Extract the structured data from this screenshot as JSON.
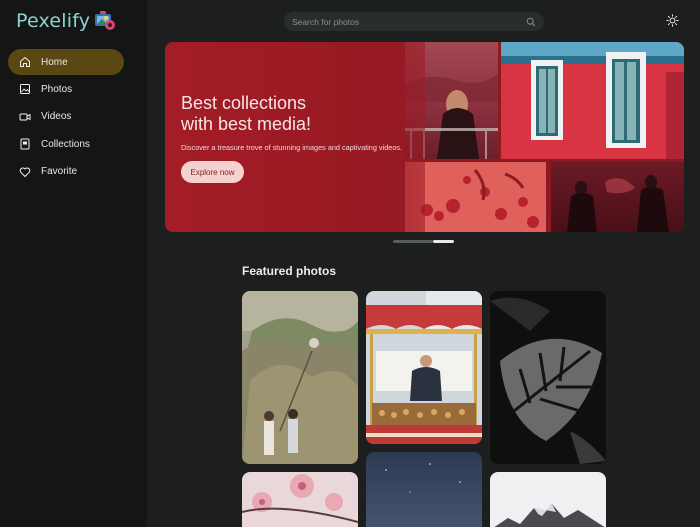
{
  "app": {
    "name": "Pexelify"
  },
  "sidebar": {
    "items": [
      {
        "label": "Home",
        "icon": "home-icon",
        "active": true
      },
      {
        "label": "Photos",
        "icon": "image-icon"
      },
      {
        "label": "Videos",
        "icon": "video-icon"
      },
      {
        "label": "Collections",
        "icon": "collections-icon"
      },
      {
        "label": "Favorite",
        "icon": "heart-icon"
      }
    ]
  },
  "search": {
    "placeholder": "Search for photos",
    "icon": "search-icon"
  },
  "theme_toggle": {
    "icon": "sun-icon"
  },
  "hero": {
    "title_line1": "Best collections",
    "title_line2": "with best media!",
    "subtitle": "Discover a treasure trove of stunning images and captivating videos.",
    "button_label": "Explore now"
  },
  "carousel": {
    "slides": 2,
    "active_index": 1
  },
  "featured": {
    "title": "Featured photos"
  },
  "colors": {
    "accent_active": "#5b4712",
    "brand": "#8ed3cf",
    "hero_red": "#a51c26",
    "button": "#f6d2cf"
  }
}
